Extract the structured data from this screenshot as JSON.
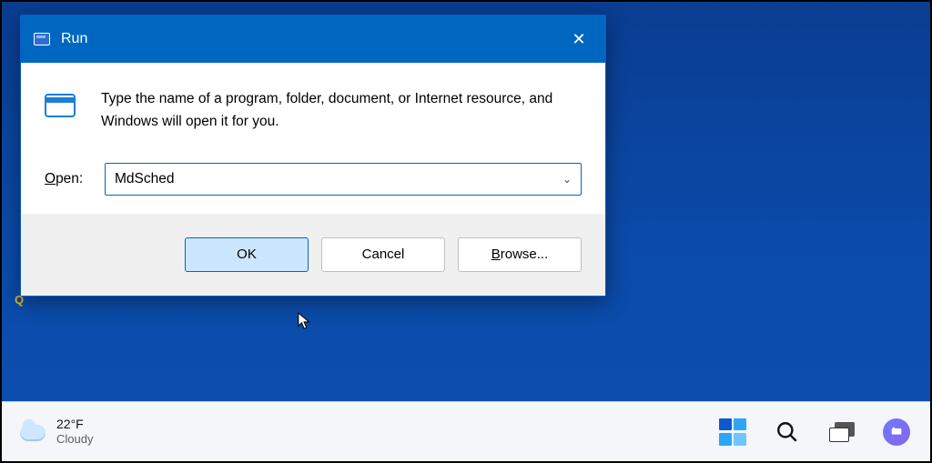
{
  "dialog": {
    "title": "Run",
    "prompt": "Type the name of a program, folder, document, or Internet resource, and Windows will open it for you.",
    "open_label_pre": "O",
    "open_label_post": "pen:",
    "open_value": "MdSched",
    "ok_label": "OK",
    "cancel_label": "Cancel",
    "browse_pre": "B",
    "browse_post": "rowse..."
  },
  "desktop": {
    "partial_icon_text": "Q"
  },
  "taskbar": {
    "temperature": "22°F",
    "condition": "Cloudy"
  }
}
